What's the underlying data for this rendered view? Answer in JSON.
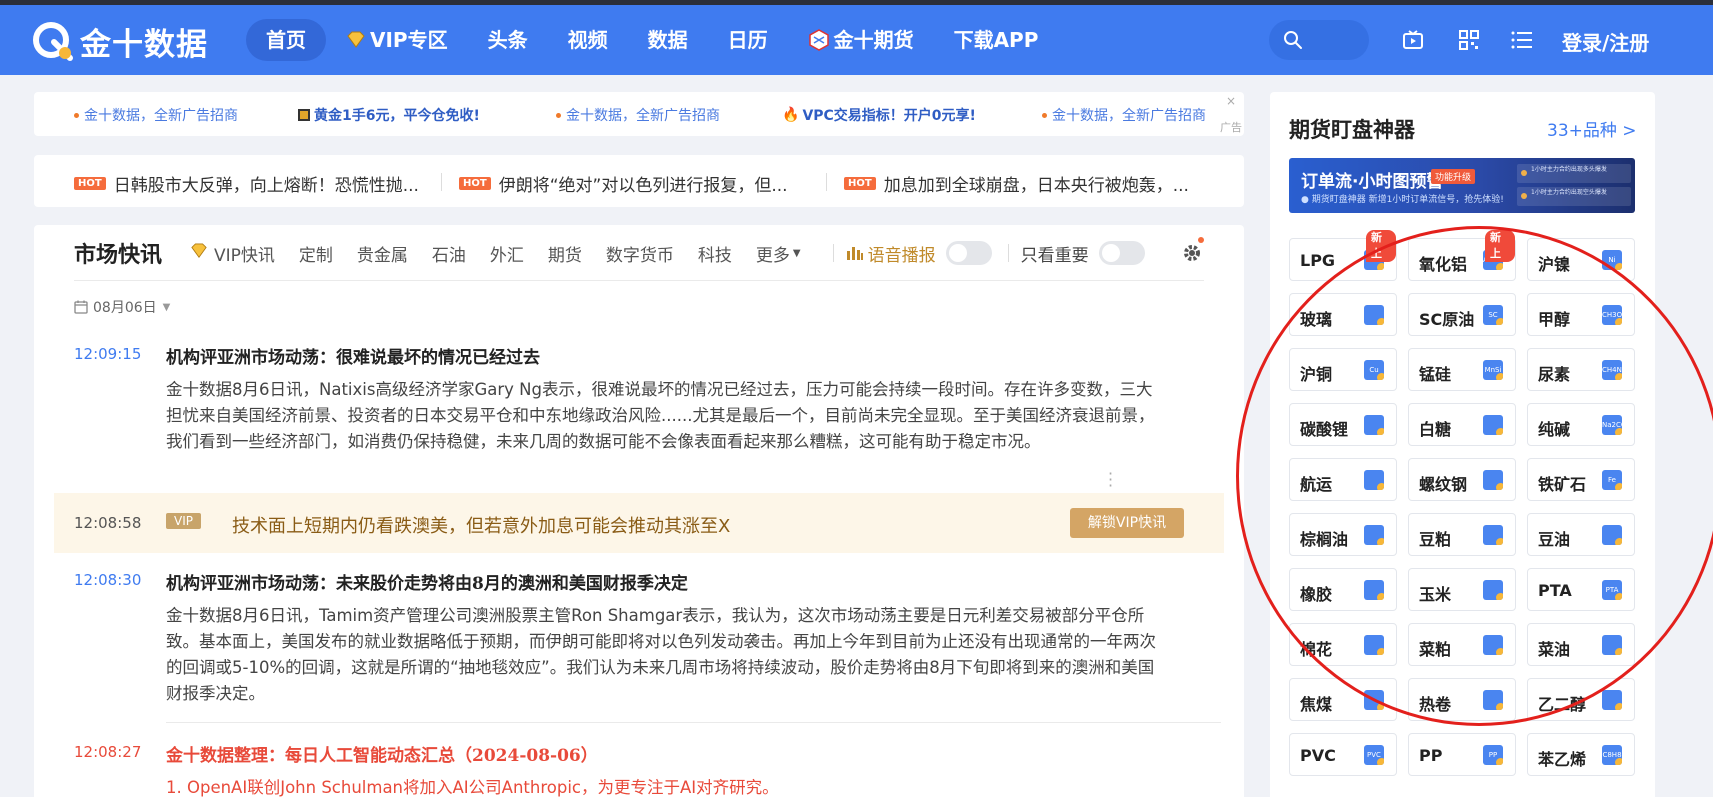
{
  "brand": {
    "name": "金十数据"
  },
  "nav": [
    {
      "label": "首页",
      "active": true,
      "icon": ""
    },
    {
      "label": "VIP专区",
      "active": false,
      "icon": "vip-diamond-icon"
    },
    {
      "label": "头条",
      "active": false,
      "icon": ""
    },
    {
      "label": "视频",
      "active": false,
      "icon": ""
    },
    {
      "label": "数据",
      "active": false,
      "icon": ""
    },
    {
      "label": "日历",
      "active": false,
      "icon": ""
    },
    {
      "label": "金十期货",
      "active": false,
      "icon": "futures-logo-icon"
    },
    {
      "label": "下载APP",
      "active": false,
      "icon": ""
    }
  ],
  "header": {
    "login_label": "登录/注册"
  },
  "ads": {
    "items": [
      {
        "text": "金十数据，全新广告招商",
        "style": "blue"
      },
      {
        "text": "黄金1手6元，平今仓免收!",
        "style": "bold"
      },
      {
        "text": "金十数据，全新广告招商",
        "style": "blue"
      },
      {
        "text": "VPC交易指标！开户0元享!",
        "style": "bold"
      },
      {
        "text": "金十数据，全新广告招商",
        "style": "blue"
      }
    ],
    "close": "×",
    "label": "广告"
  },
  "headlines": {
    "tag": "HOT",
    "items": [
      "日韩股市大反弹，向上熔断！恐慌性抛...",
      "伊朗将“绝对”对以色列进行报复，但...",
      "加息加到全球崩盘，日本央行被炮轰，..."
    ]
  },
  "feed": {
    "title": "市场快讯",
    "tabs": [
      "VIP快讯",
      "定制",
      "贵金属",
      "石油",
      "外汇",
      "期货",
      "数字货币",
      "科技",
      "更多"
    ],
    "broadcast_label": "语音播报",
    "only_important_label": "只看重要",
    "date": "08月06日",
    "news": [
      {
        "time": "12:09:15",
        "title": "机构评亚洲市场动荡：很难说最坏的情况已经过去",
        "body": "金十数据8月6日讯，Natixis高级经济学家Gary Ng表示，很难说最坏的情况已经过去，压力可能会持续一段时间。存在许多变数，三大担忧来自美国经济前景、投资者的日本交易平仓和中东地缘政治风险......尤其是最后一个，目前尚未完全显现。至于美国经济衰退前景，我们看到一些经济部门，如消费仍保持稳健，未来几周的数据可能不会像表面看起来那么糟糕，这可能有助于稳定市况。"
      },
      {
        "time": "12:08:30",
        "title": "机构评亚洲市场动荡：未来股价走势将由8月的澳洲和美国财报季决定",
        "body": "金十数据8月6日讯，Tamim资产管理公司澳洲股票主管Ron Shamgar表示，我认为，这次市场动荡主要是日元利差交易被部分平仓所致。基本面上，美国发布的就业数据略低于预期，而伊朗可能即将对以色列发动袭击。再加上今年到目前为止还没有出现通常的一年两次的回调或5-10%的回调，这就是所谓的“抽地毯效应”。我们认为未来几周市场将持续波动，股价走势将由8月下旬即将到来的澳洲和美国财报季决定。"
      },
      {
        "time": "12:08:27",
        "title": "金十数据整理：每日人工智能动态汇总（2024-08-06）",
        "body": "1. OpenAI联创John Schulman将加入AI公司Anthropic，为更专注于AI对齐研究。"
      }
    ],
    "vip_item": {
      "time": "12:08:58",
      "badge": "VIP",
      "text": "技术面上短期内仍看跌澳美，但若意外加息可能会推动其涨至X",
      "button": "解锁VIP快讯"
    }
  },
  "futures_panel": {
    "title": "期货盯盘神器",
    "more": "33+品种 >",
    "banner": {
      "headline": "订单流·小时图预警",
      "tag": "功能升级",
      "sub": "● 期货盯盘神器    新增1小时订单流信号，抢先体验!",
      "chips": [
        "1小时主力合约出现多头爆发",
        "1小时主力合约出现空头爆发"
      ]
    },
    "items": [
      {
        "label": "LPG",
        "icon": "LPG",
        "new": "新上"
      },
      {
        "label": "氧化铝",
        "icon": "Al2O3",
        "new": "新上"
      },
      {
        "label": "沪镍",
        "icon": "Ni",
        "new": ""
      },
      {
        "label": "玻璃",
        "icon": "",
        "new": ""
      },
      {
        "label": "SC原油",
        "icon": "SC",
        "new": ""
      },
      {
        "label": "甲醇",
        "icon": "CH3OH",
        "new": ""
      },
      {
        "label": "沪铜",
        "icon": "Cu",
        "new": ""
      },
      {
        "label": "锰硅",
        "icon": "MnSi",
        "new": ""
      },
      {
        "label": "尿素",
        "icon": "CH4N2O",
        "new": ""
      },
      {
        "label": "碳酸锂",
        "icon": "",
        "new": ""
      },
      {
        "label": "白糖",
        "icon": "",
        "new": ""
      },
      {
        "label": "纯碱",
        "icon": "Na2CO3",
        "new": ""
      },
      {
        "label": "航运",
        "icon": "",
        "new": ""
      },
      {
        "label": "螺纹钢",
        "icon": "",
        "new": ""
      },
      {
        "label": "铁矿石",
        "icon": "Fe",
        "new": ""
      },
      {
        "label": "棕榈油",
        "icon": "",
        "new": ""
      },
      {
        "label": "豆粕",
        "icon": "",
        "new": ""
      },
      {
        "label": "豆油",
        "icon": "",
        "new": ""
      },
      {
        "label": "橡胶",
        "icon": "",
        "new": ""
      },
      {
        "label": "玉米",
        "icon": "",
        "new": ""
      },
      {
        "label": "PTA",
        "icon": "PTA",
        "new": ""
      },
      {
        "label": "棉花",
        "icon": "",
        "new": ""
      },
      {
        "label": "菜粕",
        "icon": "",
        "new": ""
      },
      {
        "label": "菜油",
        "icon": "",
        "new": ""
      },
      {
        "label": "焦煤",
        "icon": "",
        "new": ""
      },
      {
        "label": "热卷",
        "icon": "",
        "new": ""
      },
      {
        "label": "乙二醇",
        "icon": "",
        "new": ""
      },
      {
        "label": "PVC",
        "icon": "PVC",
        "new": ""
      },
      {
        "label": "PP",
        "icon": "PP",
        "new": ""
      },
      {
        "label": "苯乙烯",
        "icon": "C8H8",
        "new": ""
      }
    ]
  },
  "colors": {
    "header_blue": "#3f7bf0",
    "accent_red": "#e84a3a",
    "vip_gold": "#d4a565",
    "annotation_red": "#e3201c"
  }
}
